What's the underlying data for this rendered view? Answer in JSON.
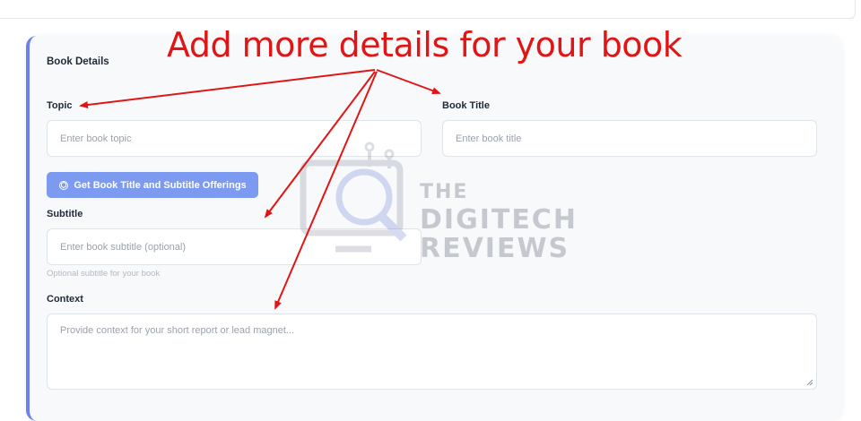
{
  "annotation": {
    "text": "Add more details for your book",
    "color": "#e01616"
  },
  "form": {
    "section_title": "Book Details",
    "topic": {
      "label": "Topic",
      "placeholder": "Enter book topic"
    },
    "book_title": {
      "label": "Book Title",
      "placeholder": "Enter book title"
    },
    "generate_button": {
      "label": "Get Book Title and Subtitle Offerings",
      "icon": "openai-icon"
    },
    "subtitle": {
      "label": "Subtitle",
      "placeholder": "Enter book subtitle (optional)",
      "help": "Optional subtitle for your book"
    },
    "context": {
      "label": "Context",
      "placeholder": "Provide context for your short report or lead magnet..."
    }
  },
  "watermark": {
    "line1": "THE",
    "line2": "DIGITECH",
    "line3": "REVIEWS"
  },
  "colors": {
    "accent": "#6b82e8",
    "button": "#7b9af0",
    "card_bg": "#f8f9fb"
  }
}
